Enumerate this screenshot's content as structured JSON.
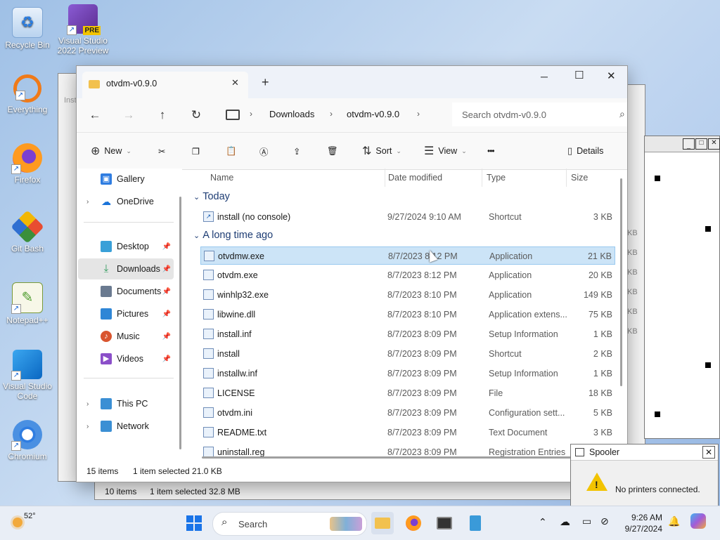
{
  "desktop": {
    "icons": [
      {
        "label": "Recycle Bin",
        "icon": "recycle-bin-icon"
      },
      {
        "label": "Visual Studio 2022 Preview",
        "icon": "visual-studio-icon",
        "badge": "PRE"
      },
      {
        "label": "Everything",
        "icon": "everything-search-icon"
      },
      {
        "label": "Firefox",
        "icon": "firefox-icon"
      },
      {
        "label": "Git Bash",
        "icon": "git-bash-icon"
      },
      {
        "label": "Notepad++",
        "icon": "notepad-plus-plus-icon"
      },
      {
        "label": "Visual Studio Code",
        "icon": "vscode-icon"
      },
      {
        "label": "Chromium",
        "icon": "chromium-icon"
      }
    ]
  },
  "bg_window": {
    "status_items": "10 items",
    "status_selected": "1 item selected  32.8 MB",
    "partial_text": "Inst",
    "size_suffix": "KB"
  },
  "explorer": {
    "tab_title": "otvdm-v0.9.0",
    "new_tab_glyph": "+",
    "window_controls": {
      "minimize": "─",
      "maximize": "☐",
      "close": "✕"
    },
    "breadcrumb": [
      "Downloads",
      "otvdm-v0.9.0"
    ],
    "search_placeholder": "Search otvdm-v0.9.0",
    "commands": {
      "new": "New",
      "sort": "Sort",
      "view": "View",
      "more": "•••",
      "details": "Details"
    },
    "sidebar": {
      "items": [
        {
          "label": "Gallery",
          "icon": "gallery-icon",
          "color": "#2f7de1"
        },
        {
          "label": "OneDrive",
          "icon": "onedrive-icon",
          "color": "#1a73d9"
        },
        {
          "label": "Desktop",
          "icon": "desktop-icon",
          "color": "#3aa0d8"
        },
        {
          "label": "Downloads",
          "icon": "downloads-icon",
          "color": "#2e9a5a"
        },
        {
          "label": "Documents",
          "icon": "documents-icon",
          "color": "#6a7a90"
        },
        {
          "label": "Pictures",
          "icon": "pictures-icon",
          "color": "#2f86d6"
        },
        {
          "label": "Music",
          "icon": "music-icon",
          "color": "#d9552f"
        },
        {
          "label": "Videos",
          "icon": "videos-icon",
          "color": "#8b4fc9"
        },
        {
          "label": "This PC",
          "icon": "this-pc-icon",
          "color": "#3b8fd4"
        },
        {
          "label": "Network",
          "icon": "network-icon",
          "color": "#3b8fd4"
        }
      ]
    },
    "columns": {
      "name": "Name",
      "date": "Date modified",
      "type": "Type",
      "size": "Size"
    },
    "groups": {
      "today": "Today",
      "long_ago": "A long time ago"
    },
    "files_today": [
      {
        "name": "install (no console)",
        "date": "9/27/2024 9:10 AM",
        "type": "Shortcut",
        "size": "3 KB"
      }
    ],
    "files_old": [
      {
        "name": "otvdmw.exe",
        "date": "8/7/2023 8:12 PM",
        "type": "Application",
        "size": "21 KB",
        "selected": true
      },
      {
        "name": "otvdm.exe",
        "date": "8/7/2023 8:12 PM",
        "type": "Application",
        "size": "20 KB"
      },
      {
        "name": "winhlp32.exe",
        "date": "8/7/2023 8:10 PM",
        "type": "Application",
        "size": "149 KB"
      },
      {
        "name": "libwine.dll",
        "date": "8/7/2023 8:10 PM",
        "type": "Application extens...",
        "size": "75 KB"
      },
      {
        "name": "install.inf",
        "date": "8/7/2023 8:09 PM",
        "type": "Setup Information",
        "size": "1 KB"
      },
      {
        "name": "install",
        "date": "8/7/2023 8:09 PM",
        "type": "Shortcut",
        "size": "2 KB"
      },
      {
        "name": "installw.inf",
        "date": "8/7/2023 8:09 PM",
        "type": "Setup Information",
        "size": "1 KB"
      },
      {
        "name": "LICENSE",
        "date": "8/7/2023 8:09 PM",
        "type": "File",
        "size": "18 KB"
      },
      {
        "name": "otvdm.ini",
        "date": "8/7/2023 8:09 PM",
        "type": "Configuration sett...",
        "size": "5 KB"
      },
      {
        "name": "README.txt",
        "date": "8/7/2023 8:09 PM",
        "type": "Text Document",
        "size": "3 KB"
      },
      {
        "name": "uninstall.reg",
        "date": "8/7/2023 8:09 PM",
        "type": "Registration Entries",
        "size": ""
      }
    ],
    "status": {
      "items": "15 items",
      "selected": "1 item selected  21.0 KB"
    }
  },
  "spooler": {
    "title": "Spooler",
    "message": "No printers connected.",
    "close": "✕"
  },
  "taskbar": {
    "weather_temp": "52°",
    "search_label": "Search",
    "time": "9:26 AM",
    "date": "9/27/2024",
    "apps": [
      "start-icon",
      "file-explorer-icon",
      "firefox-icon",
      "terminal-icon",
      "notepad-icon"
    ]
  }
}
